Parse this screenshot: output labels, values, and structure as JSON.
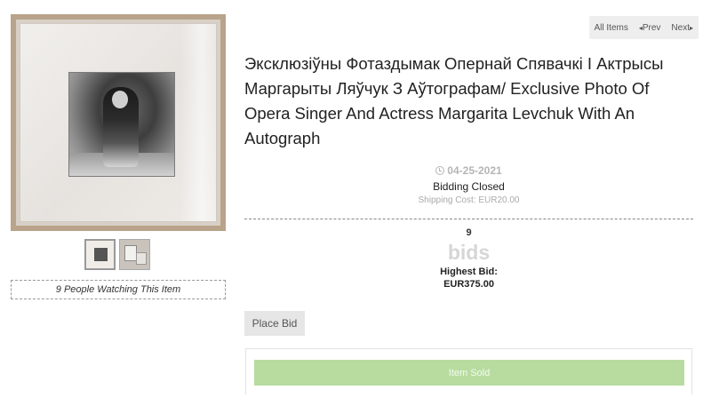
{
  "nav": {
    "all_items": "All Items",
    "prev": "Prev",
    "next": "Next"
  },
  "item": {
    "title": "Эксклюзіўны Фотаздымак Опернай Спявачкі І Актрысы Маргарыты Ляўчук З Аўтографам/ Exclusive Photo Of Opera Singer And Actress Margarita Levchuk With An Autograph",
    "watching": "9 People Watching This Item",
    "thumbnails": [
      "framed-photo-front",
      "framed-photo-angles"
    ]
  },
  "status": {
    "date": "04-25-2021",
    "bidding": "Bidding Closed",
    "shipping": "Shipping Cost: EUR20.00"
  },
  "bids": {
    "count": "9",
    "word": "bids",
    "highest_label": "Highest Bid:",
    "highest_value": "EUR375.00"
  },
  "actions": {
    "place_bid": "Place Bid",
    "item_sold": "Item Sold"
  },
  "colors": {
    "sold_button": "#b8dca0",
    "muted_text": "#b5b5b5"
  }
}
